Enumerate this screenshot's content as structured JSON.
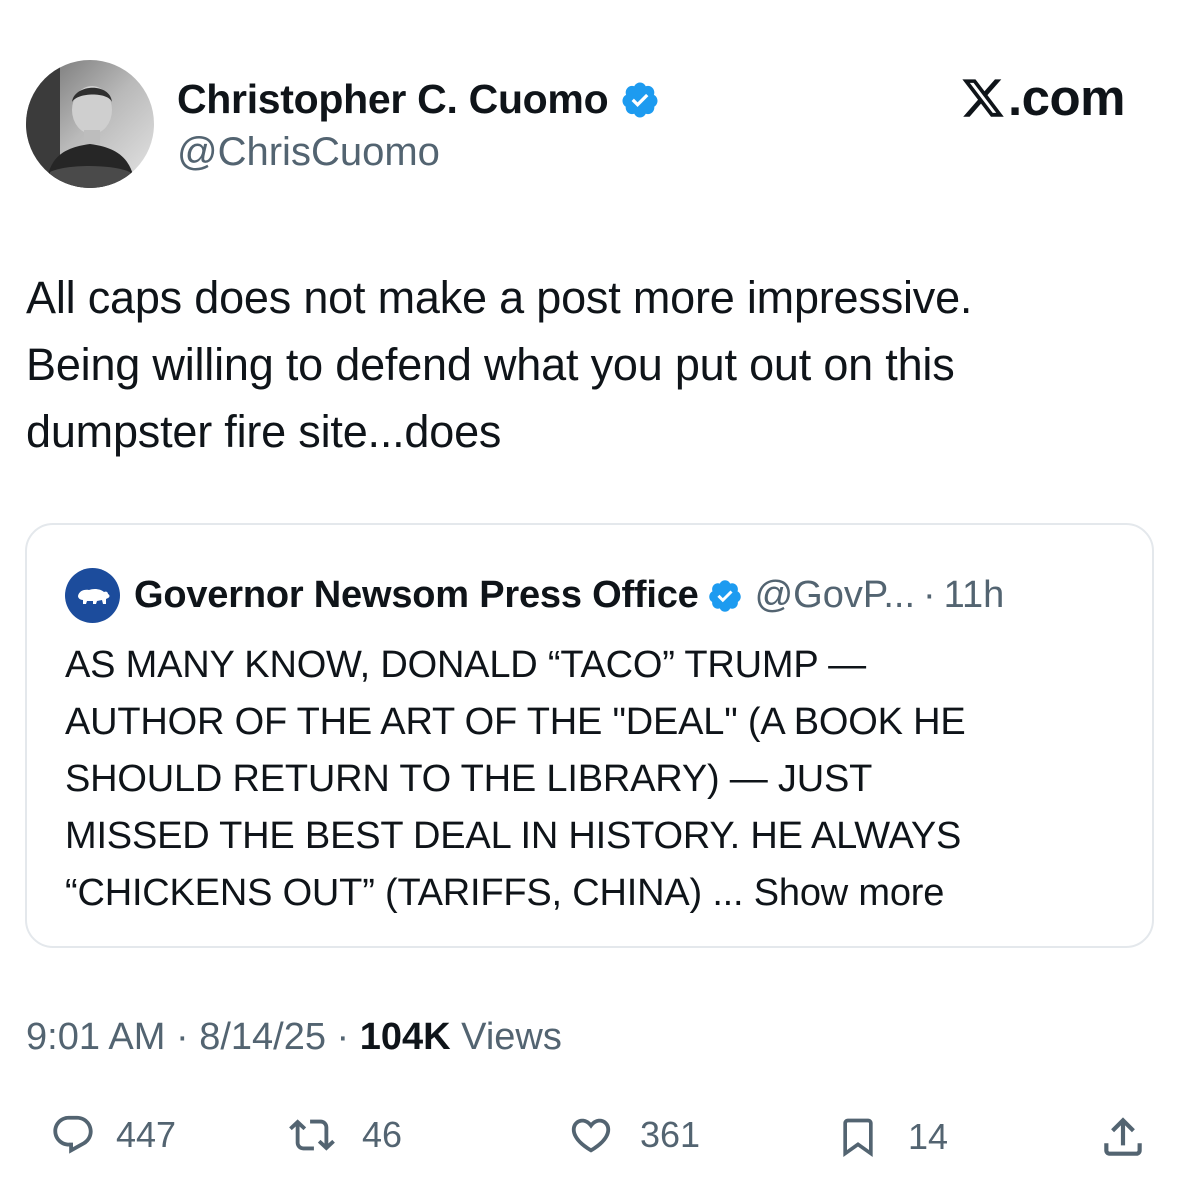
{
  "author": {
    "name": "Christopher C. Cuomo",
    "handle": "@ChrisCuomo"
  },
  "brand": {
    "label": ".com"
  },
  "post": {
    "text": "All caps does not make a post more impressive.\nBeing willing to defend what you put out on this\ndumpster fire site...does"
  },
  "quoted_post": {
    "name": "Governor Newsom Press Office",
    "handle": "@GovP...",
    "separator": "·",
    "time": "11h",
    "text": "AS MANY KNOW, DONALD “TACO” TRUMP —\nAUTHOR OF THE ART OF THE \"DEAL\" (A BOOK HE\nSHOULD RETURN TO THE LIBRARY) — JUST\nMISSED THE BEST DEAL IN HISTORY. HE ALWAYS\n“CHICKENS OUT” (TARIFFS, CHINA) ...",
    "show_more": "Show more"
  },
  "meta": {
    "time": "9:01 AM",
    "sep1": " · ",
    "date": "8/14/25",
    "sep2": " · ",
    "views_count": "104K",
    "views_label": " Views"
  },
  "actions": {
    "replies": "447",
    "reposts": "46",
    "likes": "361",
    "bookmarks": "14"
  },
  "icons": {
    "verified": "verified-badge-icon",
    "reply": "reply-icon",
    "repost": "repost-icon",
    "like": "heart-icon",
    "bookmark": "bookmark-icon",
    "share": "share-icon"
  },
  "colors": {
    "text": "#0f1419",
    "secondary": "#536471",
    "verified": "#1d9bf0",
    "card_border": "#e4e8ec",
    "quote_avatar": "#1c4c9c"
  }
}
